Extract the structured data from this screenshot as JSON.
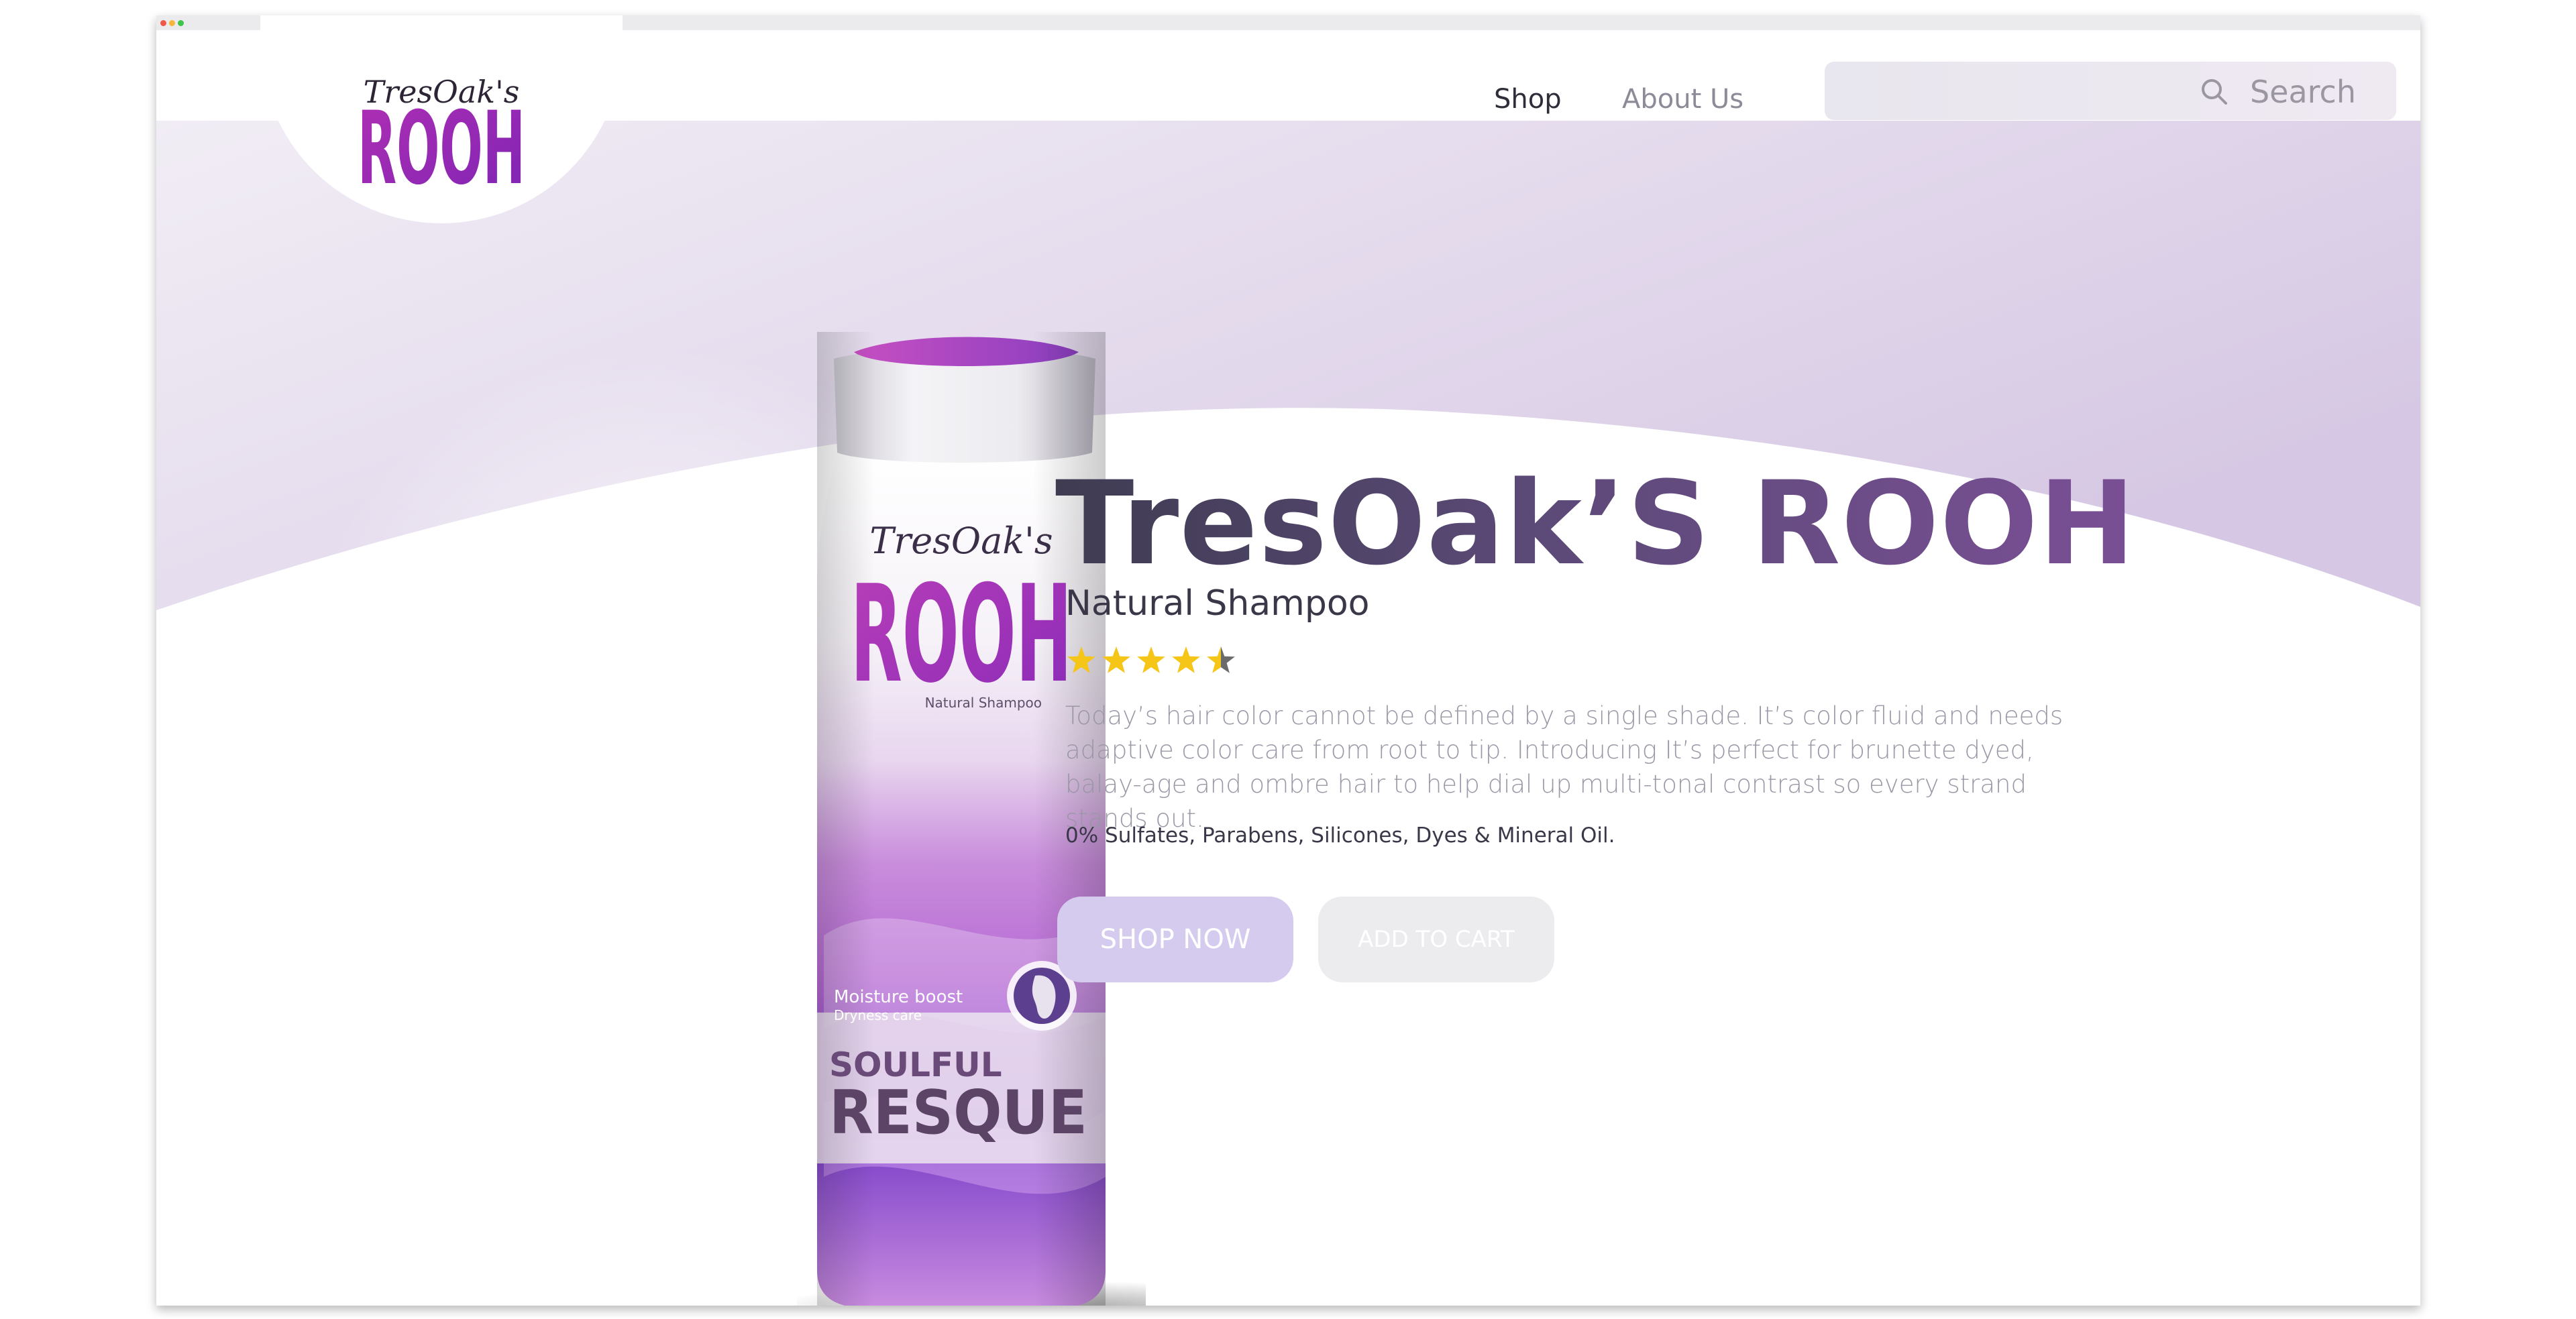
{
  "browser": {
    "dot_colors": [
      "#f1584a",
      "#f6b73c",
      "#3fc44a"
    ]
  },
  "header": {
    "logo": {
      "script_text": "TresOak's",
      "main_text": "ROOH"
    },
    "nav": [
      {
        "label": "Shop",
        "active": true
      },
      {
        "label": "About Us",
        "active": false
      }
    ],
    "search": {
      "placeholder": "Search",
      "icon": "search-icon"
    }
  },
  "product": {
    "bottle": {
      "brand_script": "TresOak's",
      "brand": "ROOH",
      "tagline": "Natural Shampoo",
      "benefit_1": "Moisture boost",
      "benefit_2": "Dryness care",
      "name_line_1": "SOULFUL",
      "name_line_2": "RESQUE"
    },
    "title": "TresOak’S ROOH",
    "subtitle": "Natural Shampoo",
    "rating": {
      "value": 4.5,
      "max": 5
    },
    "description": "Today’s hair color cannot be defined by a single shade. It’s color fluid and needs adaptive color care from root to tip. Introducing It’s perfect for brunette dyed, balay-age and ombre hair to help dial up multi-tonal contrast so every strand stands out.",
    "ingredients_note": "0% Sulfates, Parabens, Silicones, Dyes & Mineral Oil.",
    "buttons": {
      "shop_now": "SHOP NOW",
      "add_to_cart": "ADD TO CART"
    }
  },
  "colors": {
    "brand_purple": "#8a2ab8",
    "hero_lavender": "#dcd1e7",
    "star_gold": "#f5c518",
    "button_lavender": "#d5cbee"
  }
}
